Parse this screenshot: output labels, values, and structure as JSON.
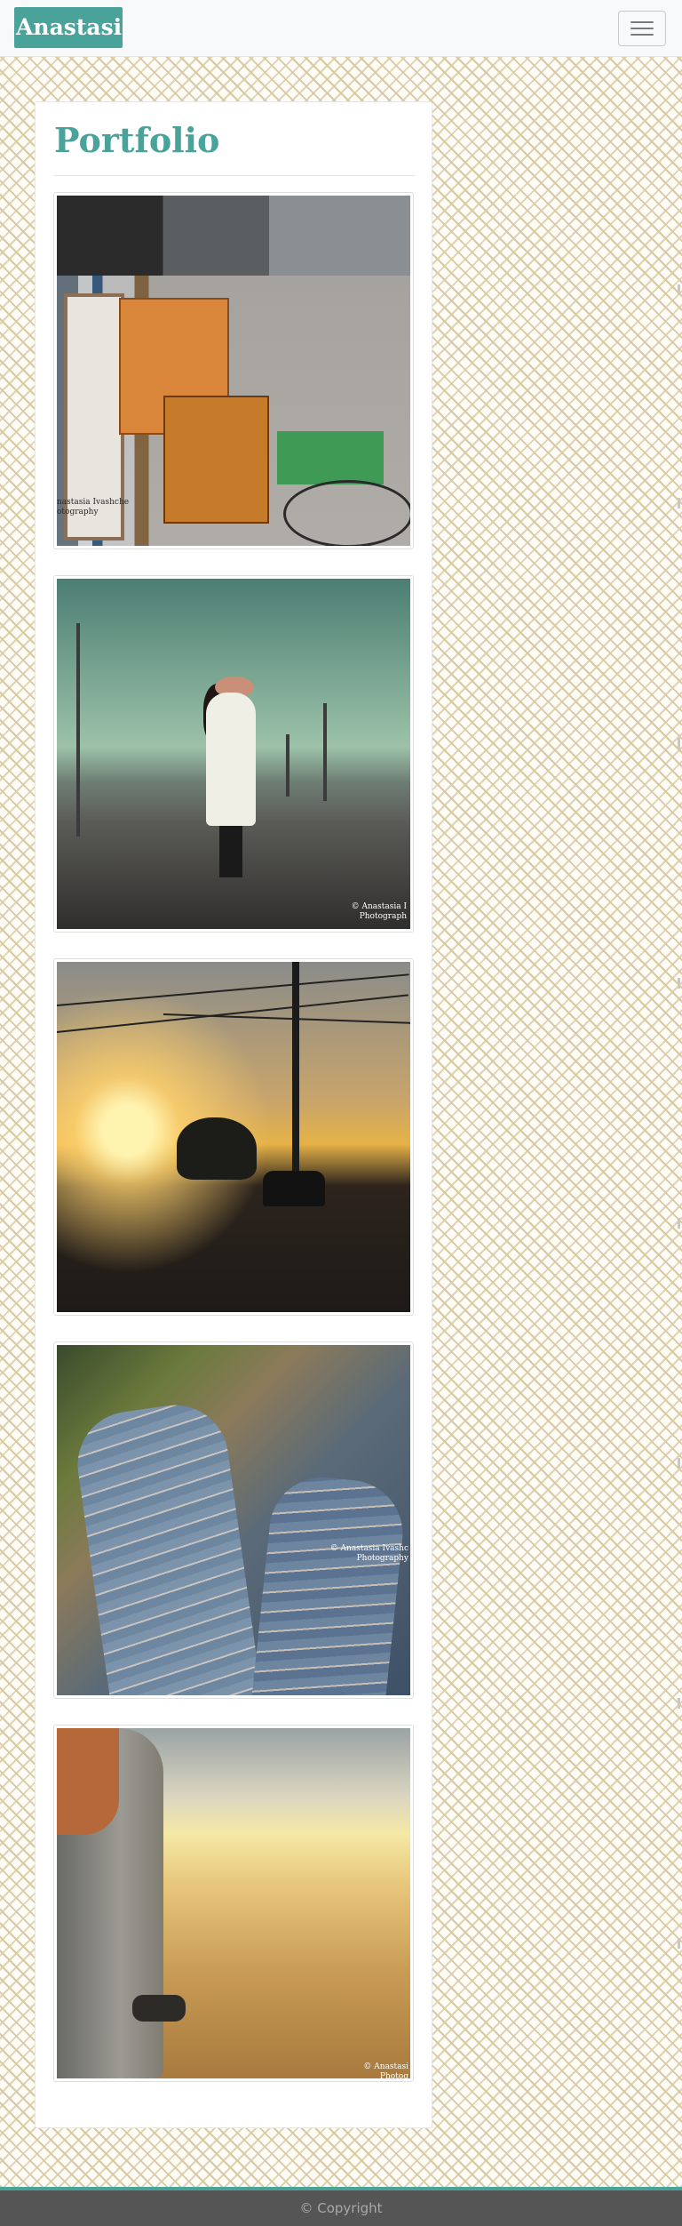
{
  "navbar": {
    "brand": "Anastasia I",
    "toggler_icon": "hamburger-icon"
  },
  "main": {
    "title": "Portfolio",
    "gallery": [
      {
        "subject": "flea market",
        "watermark": "nastasia Ivashche\notography"
      },
      {
        "subject": "girl on boardwalk",
        "watermark": "© Anastasia I\nPhotograph"
      },
      {
        "subject": "sunset street",
        "watermark": ""
      },
      {
        "subject": "torn jeans",
        "watermark": "© Anastasia Ivashc\nPhotography"
      },
      {
        "subject": "beach sand",
        "watermark": "© Anastasi\nPhotog"
      }
    ]
  },
  "footer": {
    "copyright": "© Copyright"
  },
  "colors": {
    "accent": "#4aa39a",
    "navbar_bg": "#f8f9fa",
    "footer_bg": "#555555"
  }
}
